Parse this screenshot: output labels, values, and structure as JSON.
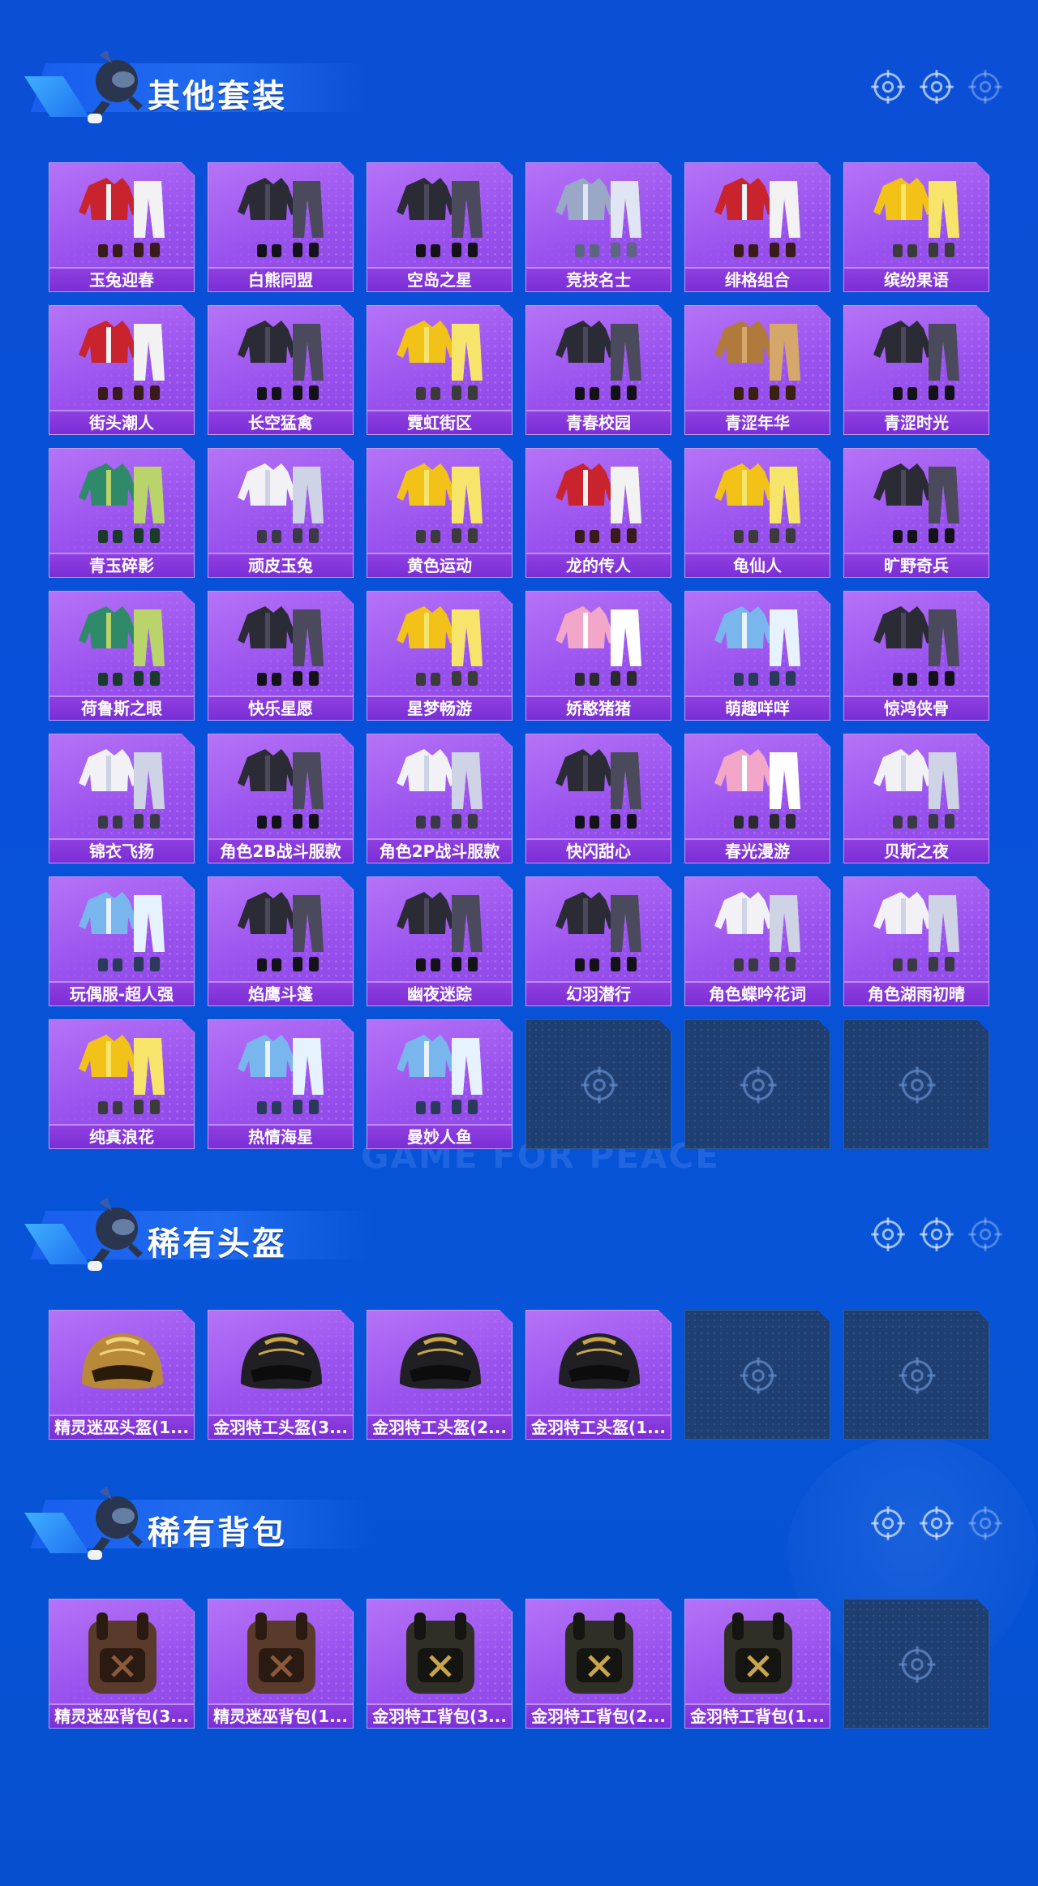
{
  "watermark": "GAME FOR PEACE",
  "sections": [
    {
      "title": "其他套装",
      "items": [
        {
          "label": "玉兔迎春",
          "art": "outfit-red"
        },
        {
          "label": "白熊同盟",
          "art": "outfit-dark"
        },
        {
          "label": "空岛之星",
          "art": "outfit-dark"
        },
        {
          "label": "竞技名士",
          "art": "outfit-gray"
        },
        {
          "label": "绯格组合",
          "art": "outfit-red"
        },
        {
          "label": "缤纷果语",
          "art": "outfit-yellow"
        },
        {
          "label": "街头潮人",
          "art": "outfit-red"
        },
        {
          "label": "长空猛禽",
          "art": "outfit-dark"
        },
        {
          "label": "霓虹街区",
          "art": "outfit-yellow"
        },
        {
          "label": "青春校园",
          "art": "outfit-dark"
        },
        {
          "label": "青涩年华",
          "art": "outfit-brown"
        },
        {
          "label": "青涩时光",
          "art": "outfit-dark"
        },
        {
          "label": "青玉碎影",
          "art": "outfit-green"
        },
        {
          "label": "顽皮玉兔",
          "art": "outfit-white"
        },
        {
          "label": "黄色运动",
          "art": "outfit-yellow"
        },
        {
          "label": "龙的传人",
          "art": "outfit-red"
        },
        {
          "label": "龟仙人",
          "art": "outfit-yellow"
        },
        {
          "label": "旷野奇兵",
          "art": "outfit-dark"
        },
        {
          "label": "荷鲁斯之眼",
          "art": "outfit-green"
        },
        {
          "label": "快乐星愿",
          "art": "outfit-dark"
        },
        {
          "label": "星梦畅游",
          "art": "outfit-yellow"
        },
        {
          "label": "娇憨猪猪",
          "art": "outfit-pink"
        },
        {
          "label": "萌趣咩咩",
          "art": "outfit-blue"
        },
        {
          "label": "惊鸿侠骨",
          "art": "outfit-dark"
        },
        {
          "label": "锦衣飞扬",
          "art": "outfit-white"
        },
        {
          "label": "角色2B战斗服款",
          "art": "outfit-dark"
        },
        {
          "label": "角色2P战斗服款",
          "art": "outfit-white"
        },
        {
          "label": "快闪甜心",
          "art": "outfit-dark"
        },
        {
          "label": "春光漫游",
          "art": "outfit-pink"
        },
        {
          "label": "贝斯之夜",
          "art": "outfit-white"
        },
        {
          "label": "玩偶服-超人强",
          "art": "outfit-blue"
        },
        {
          "label": "焰鹰斗篷",
          "art": "outfit-dark"
        },
        {
          "label": "幽夜迷踪",
          "art": "outfit-dark"
        },
        {
          "label": "幻羽潜行",
          "art": "outfit-dark"
        },
        {
          "label": "角色蝶吟花词",
          "art": "outfit-white"
        },
        {
          "label": "角色湖雨初晴",
          "art": "outfit-white"
        },
        {
          "label": "纯真浪花",
          "art": "outfit-yellow"
        },
        {
          "label": "热情海星",
          "art": "outfit-blue"
        },
        {
          "label": "曼妙人鱼",
          "art": "outfit-blue"
        }
      ],
      "empty_slots": 3
    },
    {
      "title": "稀有头盔",
      "items": [
        {
          "label": "精灵迷巫头盔(1...",
          "art": "helmet-gold"
        },
        {
          "label": "金羽特工头盔(3...",
          "art": "helmet-dark"
        },
        {
          "label": "金羽特工头盔(2...",
          "art": "helmet-dark"
        },
        {
          "label": "金羽特工头盔(1...",
          "art": "helmet-dark"
        }
      ],
      "empty_slots": 2
    },
    {
      "title": "稀有背包",
      "items": [
        {
          "label": "精灵迷巫背包(3...",
          "art": "backpack-brown"
        },
        {
          "label": "精灵迷巫背包(1...",
          "art": "backpack-brown"
        },
        {
          "label": "金羽特工背包(3...",
          "art": "backpack-dark"
        },
        {
          "label": "金羽特工背包(2...",
          "art": "backpack-dark"
        },
        {
          "label": "金羽特工背包(1...",
          "art": "backpack-dark"
        }
      ],
      "empty_slots": 1
    }
  ],
  "icons": {
    "crosshair": "crosshair-icon",
    "mascot": "mascot-icon"
  },
  "colors": {
    "background": "#0a4fd6",
    "tile_purple": "#9a52ee",
    "label_purple": "#7a2ed6",
    "empty_tile": "#1f3f73"
  }
}
